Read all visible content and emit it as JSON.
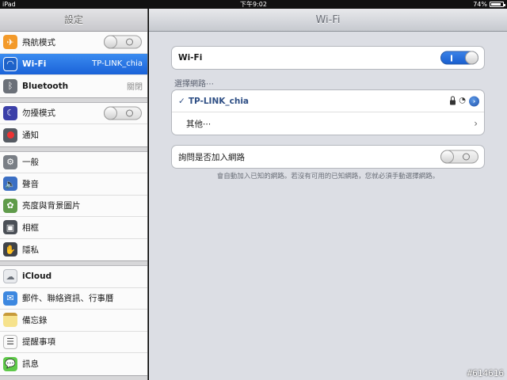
{
  "status_bar": {
    "device": "iPad",
    "time": "下午9:02",
    "battery": "74%"
  },
  "sidebar": {
    "title": "設定",
    "groups": [
      [
        {
          "label": "飛航模式",
          "icon": "airplane-icon",
          "control": "switch-off"
        },
        {
          "label": "Wi-Fi",
          "value": "TP-LINK_chia",
          "icon": "wifi-icon",
          "selected": true
        },
        {
          "label": "Bluetooth",
          "value": "關閉",
          "icon": "bluetooth-icon"
        }
      ],
      [
        {
          "label": "勿擾模式",
          "icon": "moon-icon",
          "control": "switch-off"
        },
        {
          "label": "通知",
          "icon": "notification-icon"
        }
      ],
      [
        {
          "label": "一般",
          "icon": "gear-icon"
        },
        {
          "label": "聲音",
          "icon": "speaker-icon"
        },
        {
          "label": "亮度與背景圖片",
          "icon": "brightness-icon"
        },
        {
          "label": "相框",
          "icon": "picture-frame-icon"
        },
        {
          "label": "隱私",
          "icon": "hand-icon"
        }
      ],
      [
        {
          "label": "iCloud",
          "icon": "cloud-icon"
        },
        {
          "label": "郵件、聯絡資訊、行事曆",
          "icon": "mail-icon"
        },
        {
          "label": "備忘錄",
          "icon": "notes-icon"
        },
        {
          "label": "提醒事項",
          "icon": "reminders-icon"
        },
        {
          "label": "訊息",
          "icon": "messages-icon"
        }
      ]
    ]
  },
  "main": {
    "title": "Wi-Fi",
    "wifi_toggle": {
      "label": "Wi-Fi",
      "state": "on",
      "on_mark": "I"
    },
    "choose_network_label": "選擇網路⋯",
    "networks": [
      {
        "name": "TP-LINK_chia",
        "selected": true,
        "check": "✓",
        "info": "›"
      },
      {
        "name": "其他⋯"
      }
    ],
    "ask_to_join": {
      "label": "詢問是否加入網路",
      "state": "off"
    },
    "hint": "會自動加入已知的網路。若沒有可用的已知網路，您就必須手動選擇網路。"
  },
  "watermark": "#614616",
  "colors": {
    "selected_blue": "#1a62d8",
    "network_text": "#2f4f85",
    "switch_on": "#1a5fcf"
  }
}
